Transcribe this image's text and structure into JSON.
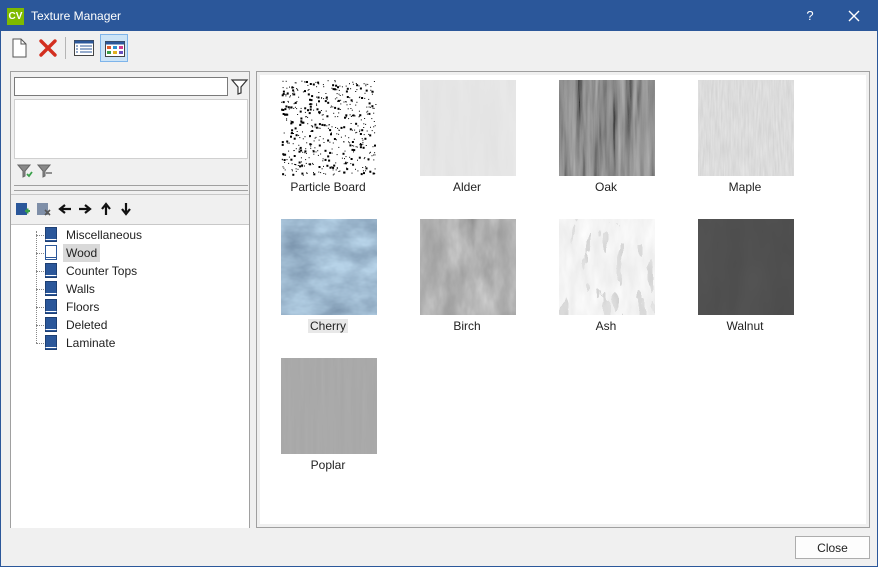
{
  "window": {
    "logo_text": "CV",
    "title": "Texture Manager",
    "help_label": "?"
  },
  "toolbar": {
    "buttons": [
      {
        "icon": "new-document-icon"
      },
      {
        "icon": "delete-icon",
        "color": "#d32f1f"
      },
      {
        "icon": "list-view-icon"
      },
      {
        "icon": "thumbnail-view-icon",
        "active": true
      }
    ]
  },
  "filter": {
    "search_value": "",
    "search_placeholder": ""
  },
  "tree": {
    "items": [
      {
        "label": "Miscellaneous",
        "selected": false
      },
      {
        "label": "Wood",
        "selected": true
      },
      {
        "label": "Counter Tops",
        "selected": false
      },
      {
        "label": "Walls",
        "selected": false
      },
      {
        "label": "Floors",
        "selected": false
      },
      {
        "label": "Deleted",
        "selected": false
      },
      {
        "label": "Laminate",
        "selected": false
      }
    ]
  },
  "textures": [
    {
      "label": "Particle Board",
      "style": "particle"
    },
    {
      "label": "Alder",
      "style": "alder"
    },
    {
      "label": "Oak",
      "style": "oak"
    },
    {
      "label": "Maple",
      "style": "maple"
    },
    {
      "label": "Cherry",
      "style": "cherry",
      "selected": true
    },
    {
      "label": "Birch",
      "style": "birch"
    },
    {
      "label": "Ash",
      "style": "ash"
    },
    {
      "label": "Walnut",
      "style": "walnut"
    },
    {
      "label": "Poplar",
      "style": "poplar"
    }
  ],
  "footer": {
    "close_label": "Close"
  },
  "colors": {
    "title_bar": "#2b579a",
    "logo": "#7fba00",
    "folder": "#2b579a",
    "selection": "#d9d9d9"
  }
}
